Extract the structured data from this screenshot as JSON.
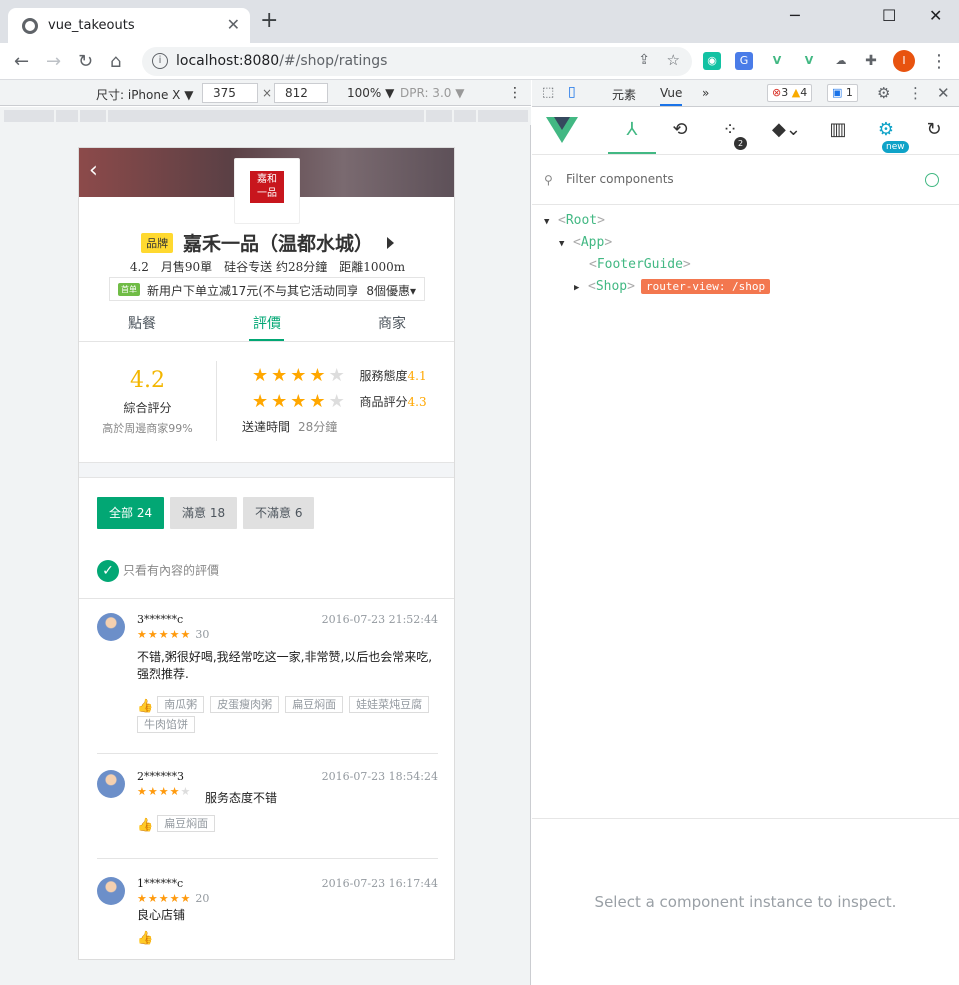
{
  "browser": {
    "tab_title": "vue_takeouts",
    "tab_close": "✕",
    "new_tab": "+",
    "url_host": "localhost:8080",
    "url_path": "/#/shop/ratings",
    "win_min": "─",
    "win_max": "☐",
    "win_close": "✕",
    "profile_initial": "I"
  },
  "device_toolbar": {
    "device_label": "尺寸: iPhone X ▼",
    "width": "375",
    "times": "×",
    "height": "812",
    "zoom": "100% ▼",
    "dpr": "DPR: 3.0 ▼",
    "more": "⋮"
  },
  "shop": {
    "back": "‹",
    "logo_text": "嘉和\n一品",
    "brand_tag": "品牌",
    "name": "嘉禾一品（温都水城）",
    "meta": "4.2　月售90單　硅谷专送 约28分鐘　距離1000m",
    "promo_tag": "首单",
    "promo_text": "新用户下单立减17元(不与其它活动同享)",
    "promo_more": "8個優惠▾",
    "tabs": [
      "點餐",
      "評價",
      "商家"
    ]
  },
  "ratings_overview": {
    "score": "4.2",
    "score_label": "綜合評分",
    "rank_text": "高於周邊商家99%",
    "service_label": "服務態度",
    "service_score": "4.1",
    "food_label": "商品評分",
    "food_score": "4.3",
    "delivery_label": "送達時間",
    "delivery_time": "28分鐘",
    "service_stars": 4,
    "food_stars": 4
  },
  "filters": {
    "all": "全部 24",
    "satisfied": "滿意 18",
    "unsatisfied": "不滿意 6",
    "only_content": "只看有內容的評價",
    "check": "✓"
  },
  "reviews": [
    {
      "user": "3******c",
      "time": "2016-07-23 21:52:44",
      "stars": 5,
      "delivery": "30",
      "text": "不错,粥很好喝,我经常吃这一家,非常赞,以后也会常来吃,强烈推荐.",
      "dishes": [
        "南瓜粥",
        "皮蛋瘦肉粥",
        "扁豆焖面",
        "娃娃菜炖豆腐",
        "牛肉馅饼"
      ]
    },
    {
      "user": "2******3",
      "time": "2016-07-23 18:54:24",
      "stars": 4,
      "delivery": "",
      "text": "服务态度不错",
      "dishes": [
        "扁豆焖面"
      ]
    },
    {
      "user": "1******c",
      "time": "2016-07-23 16:17:44",
      "stars": 5,
      "delivery": "20",
      "text": "良心店铺",
      "dishes": []
    }
  ],
  "devtools": {
    "tab_elements": "元素",
    "tab_vue": "Vue",
    "more_tabs": "»",
    "errors": "3",
    "warnings": "4",
    "messages": "1",
    "filter_placeholder": "Filter components",
    "tree": [
      {
        "name": "Root",
        "twisty": "▼"
      },
      {
        "name": "App",
        "twisty": "▼"
      },
      {
        "name": "FooterGuide",
        "twisty": ""
      },
      {
        "name": "Shop",
        "twisty": "▶"
      }
    ],
    "router_badge": "router-view: /shop",
    "timeline_count": "2",
    "new_badge": "new",
    "inspect_message": "Select a component instance to inspect."
  }
}
